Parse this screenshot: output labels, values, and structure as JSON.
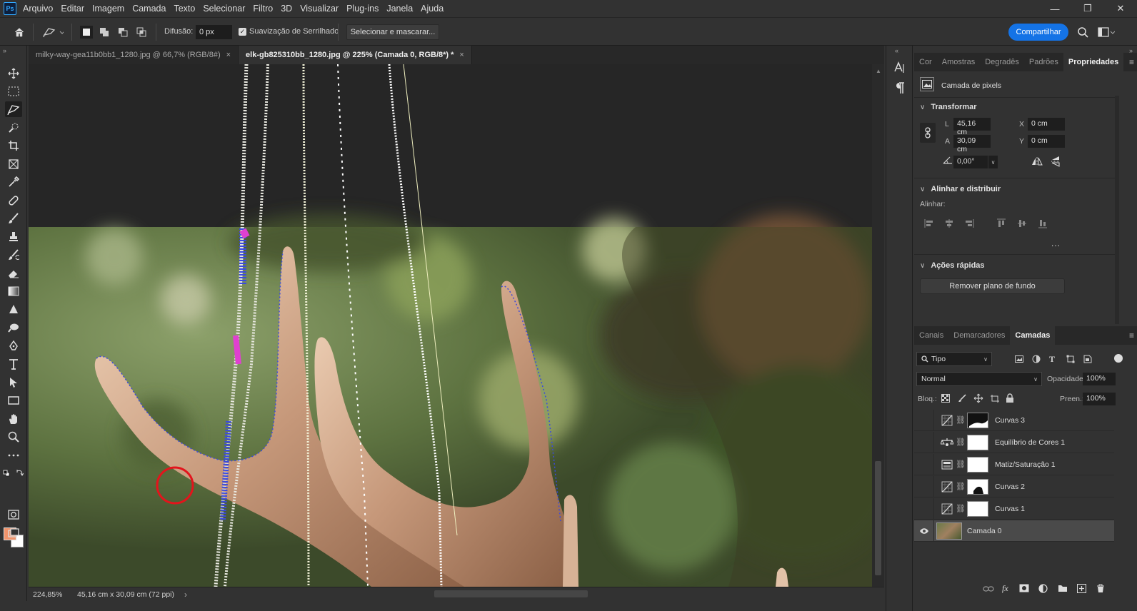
{
  "app": {
    "logo": "Ps"
  },
  "menu": [
    "Arquivo",
    "Editar",
    "Imagem",
    "Camada",
    "Texto",
    "Selecionar",
    "Filtro",
    "3D",
    "Visualizar",
    "Plug-ins",
    "Janela",
    "Ajuda"
  ],
  "window_controls": {
    "minimize": "—",
    "restore": "❐",
    "close": "✕"
  },
  "options": {
    "feather_label": "Difusão:",
    "feather_value": "0 px",
    "antialias_label": "Suavização de Serrilhado",
    "antialias_checked": true,
    "select_mask_label": "Selecionar e mascarar...",
    "share_label": "Compartilhar"
  },
  "tabs": [
    {
      "label": "milky-way-gea11b0bb1_1280.jpg @ 66,7% (RGB/8#)",
      "close": "×",
      "active": false
    },
    {
      "label": "elk-gb825310bb_1280.jpg @ 225% (Camada 0, RGB/8*) *",
      "close": "×",
      "active": true
    }
  ],
  "status": {
    "zoom": "224,85%",
    "doc_size": "45,16 cm x 30,09 cm (72 ppi)",
    "arrow": "›"
  },
  "colors": {
    "foreground": "#f0946c",
    "background": "#ffffff",
    "accent": "#1473e6"
  },
  "properties": {
    "tabs": [
      "Cor",
      "Amostras",
      "Degradês",
      "Padrões",
      "Propriedades"
    ],
    "active_tab": "Propriedades",
    "layer_kind": "Camada de pixels",
    "transform": {
      "title": "Transformar",
      "w_label": "L",
      "w_value": "45,16 cm",
      "h_label": "A",
      "h_value": "30,09 cm",
      "x_label": "X",
      "x_value": "0 cm",
      "y_label": "Y",
      "y_value": "0 cm",
      "angle_value": "0,00°"
    },
    "align": {
      "title": "Alinhar e distribuir",
      "label": "Alinhar:",
      "more": "..."
    },
    "quick_actions": {
      "title": "Ações rápidas",
      "remove_bg": "Remover plano de fundo"
    }
  },
  "layers_panel": {
    "tabs": [
      "Canais",
      "Demarcadores",
      "Camadas"
    ],
    "active_tab": "Camadas",
    "filter_label": "Tipo",
    "blend_mode": "Normal",
    "opacity_label": "Opacidade:",
    "opacity_value": "100%",
    "lock_label": "Bloq.:",
    "fill_label": "Preen.:",
    "fill_value": "100%",
    "layers": [
      {
        "name": "Curvas 3",
        "type": "curves",
        "visible": false,
        "selected": false
      },
      {
        "name": "Equilíbrio de Cores 1",
        "type": "color-balance",
        "visible": false,
        "selected": false
      },
      {
        "name": "Matiz/Saturação 1",
        "type": "hue-saturation",
        "visible": false,
        "selected": false
      },
      {
        "name": "Curvas 2",
        "type": "curves",
        "visible": false,
        "selected": false
      },
      {
        "name": "Curvas 1",
        "type": "curves",
        "visible": false,
        "selected": false
      },
      {
        "name": "Camada 0",
        "type": "pixel",
        "visible": true,
        "selected": true
      }
    ]
  }
}
